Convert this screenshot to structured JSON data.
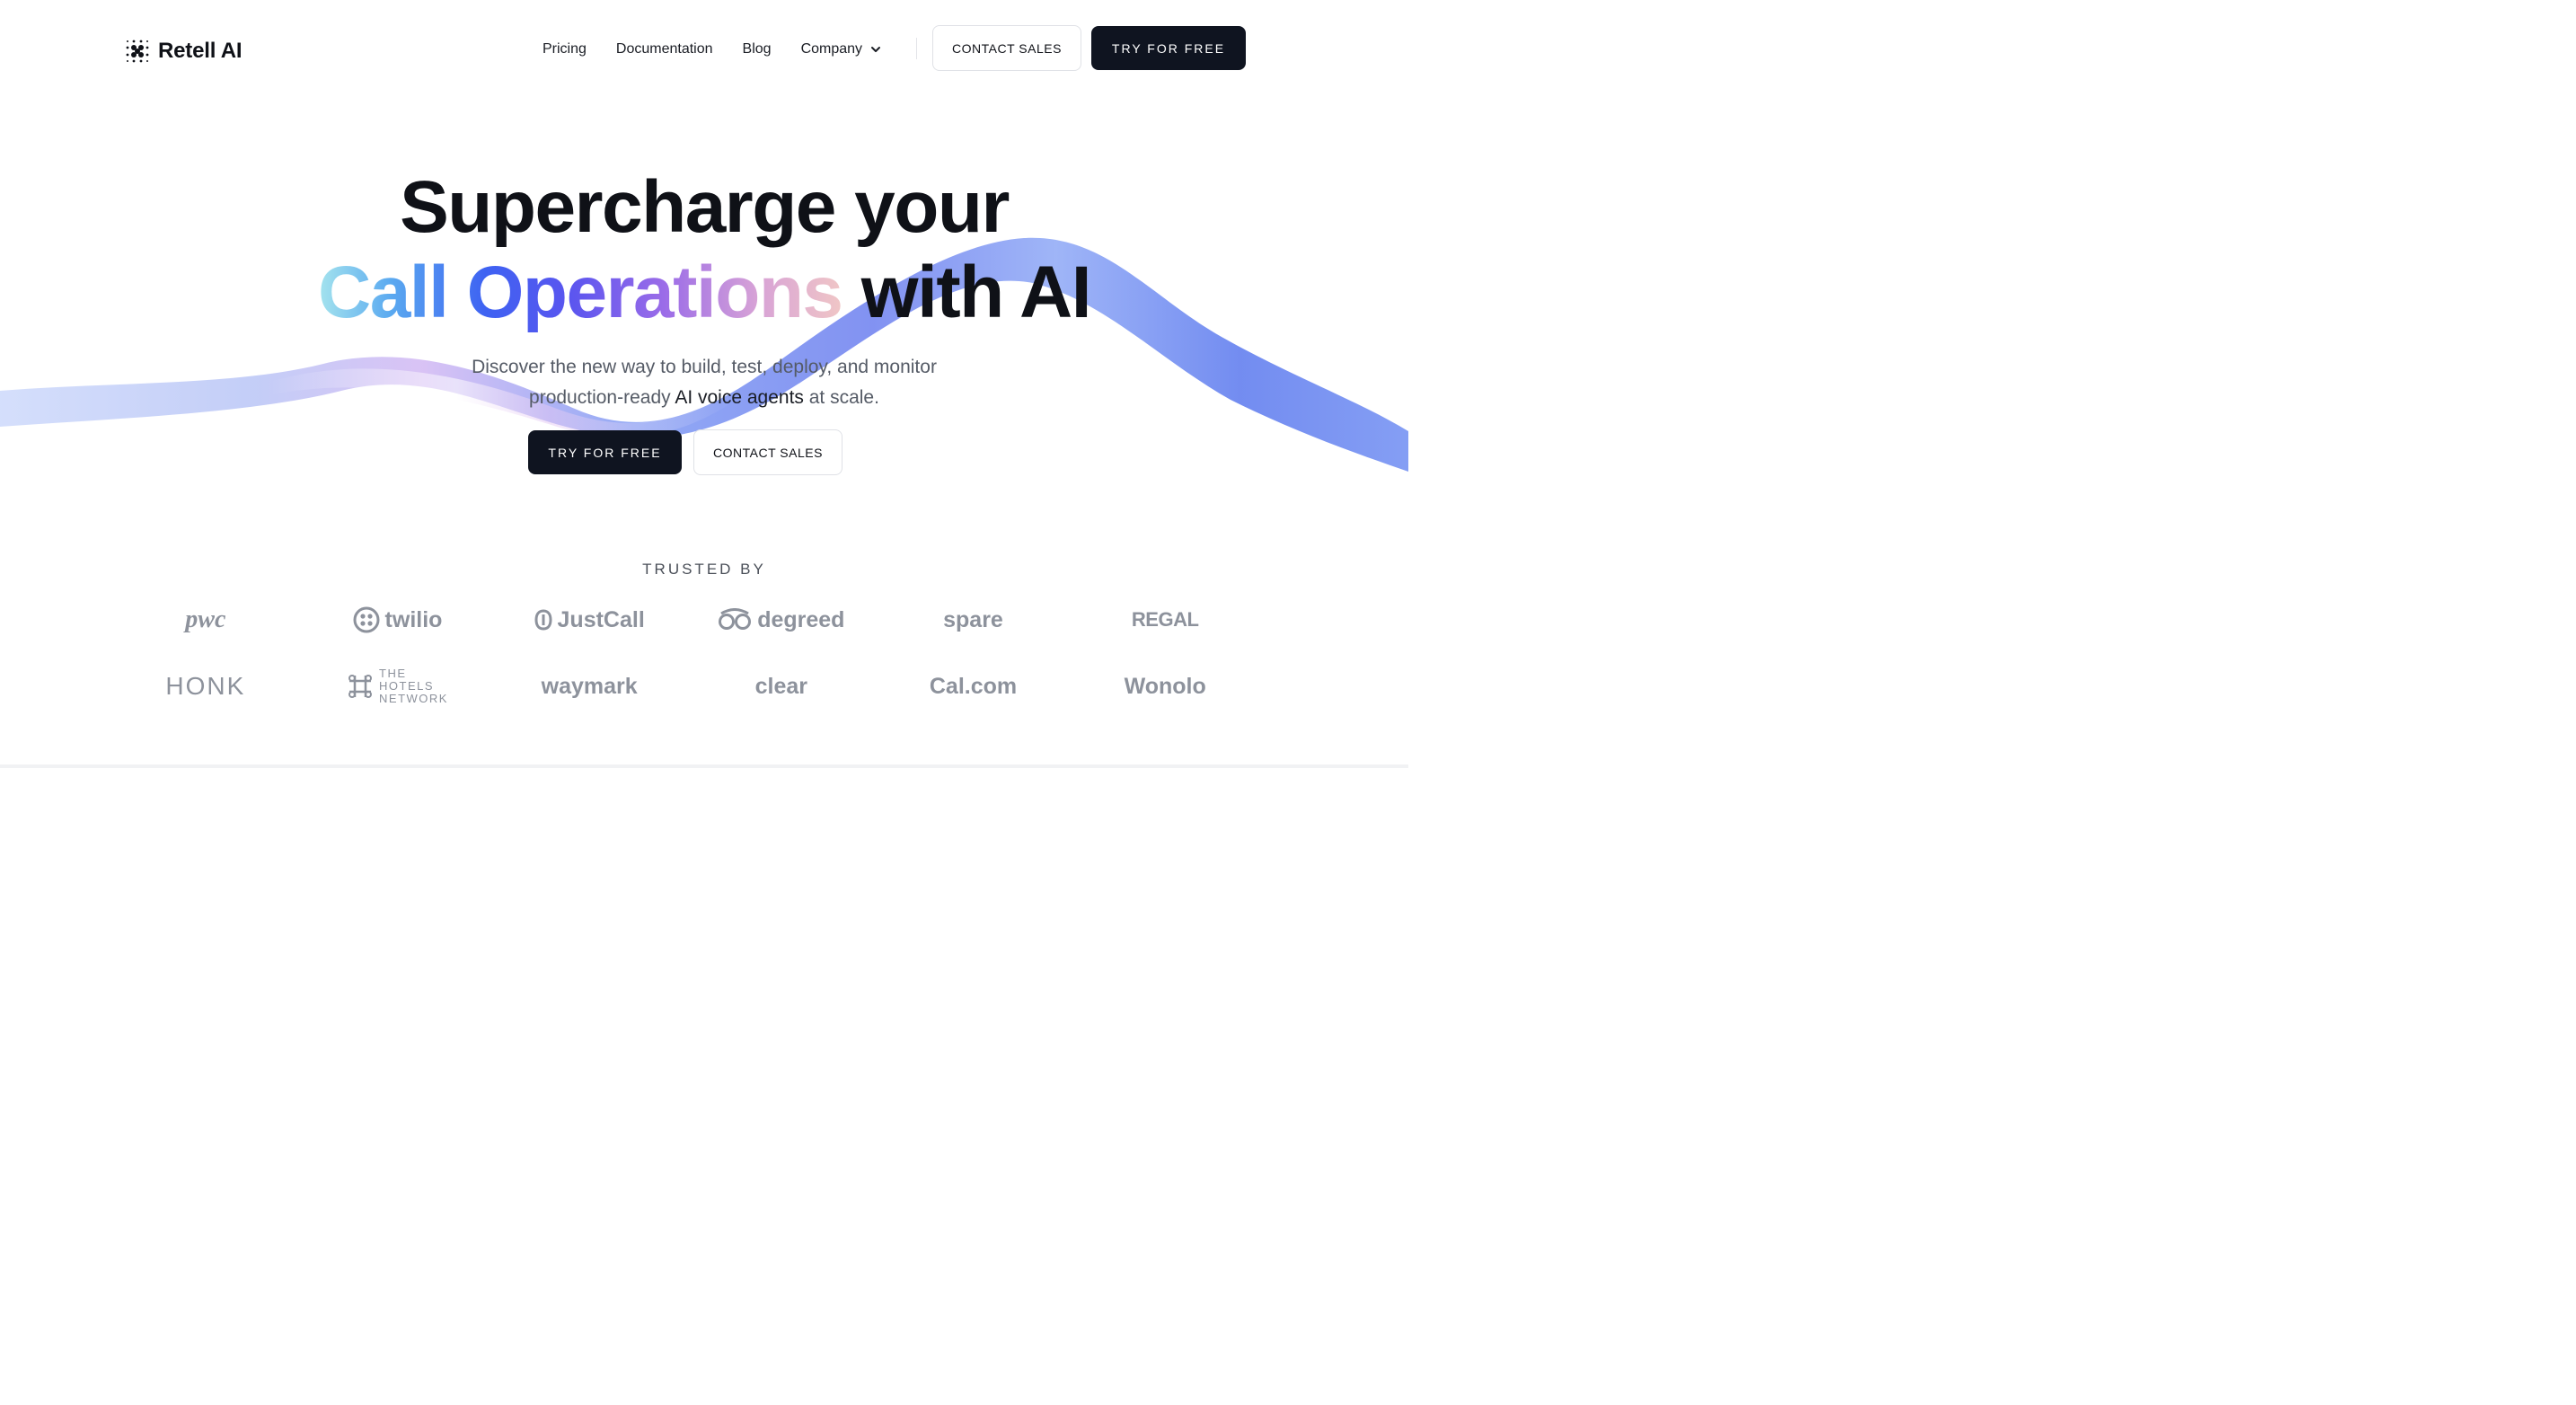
{
  "brand": {
    "name": "Retell AI",
    "logo_icon": "dotted-grid-logo"
  },
  "nav": {
    "links": [
      "Pricing",
      "Documentation",
      "Blog"
    ],
    "company_label": "Company",
    "contact_sales": "CONTACT SALES",
    "try_free": "TRY FOR FREE"
  },
  "hero": {
    "line1": "Supercharge your",
    "line2_gradient": "Call Operations",
    "line2_dark": " with AI",
    "subtitle_part1": "Discover the new way to build, test, deploy, and monitor",
    "subtitle_part2_pre": "production-ready ",
    "subtitle_highlight": "AI voice agents",
    "subtitle_part2_post": " at scale.",
    "cta_primary": "TRY FOR FREE",
    "cta_secondary": "CONTACT SALES"
  },
  "trusted": {
    "heading": "TRUSTED BY",
    "logos": [
      "pwc",
      "twilio",
      "JustCall",
      "degreed",
      "spare",
      "REGAL",
      "HONK",
      "THE HOTELS NETWORK",
      "waymark",
      "clear",
      "Cal.com",
      "Wonolo"
    ],
    "hotels_lines": [
      "THE",
      "HOTELS",
      "NETWORK"
    ]
  },
  "colors": {
    "dark": "#0f1420",
    "gradient": [
      "#a5e4ee",
      "#3e62f2",
      "#9b6ce8",
      "#f0c6c6"
    ],
    "logo_gray": "#8d929c"
  }
}
